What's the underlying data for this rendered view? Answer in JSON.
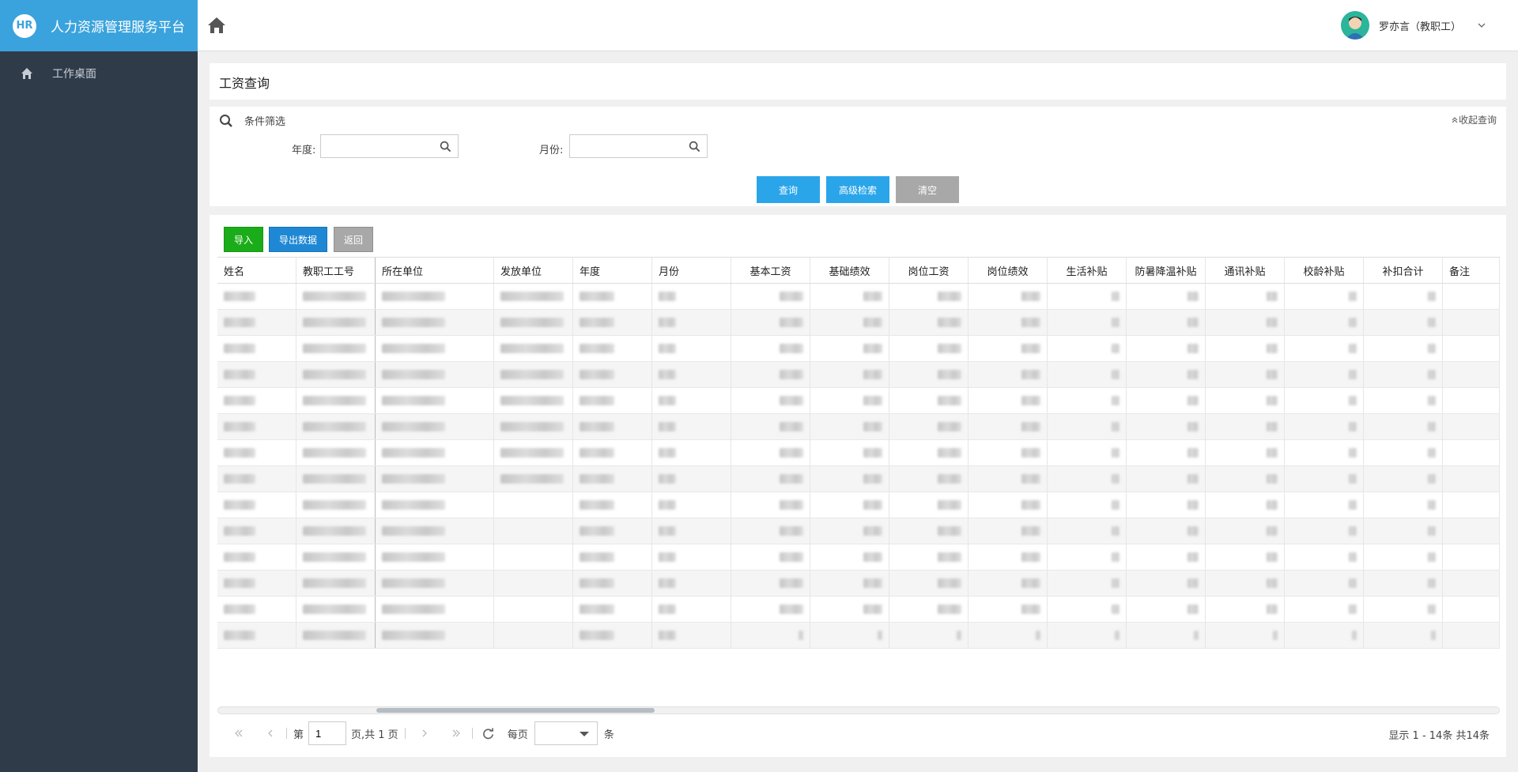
{
  "app": {
    "logo_text": "HR",
    "title": "人力资源管理服务平台"
  },
  "sidebar": {
    "items": [
      {
        "label": "工作桌面",
        "icon": "home-icon"
      }
    ]
  },
  "topbar": {
    "user_name": "罗亦言（教职工）"
  },
  "page": {
    "title": "工资查询"
  },
  "filter": {
    "header": "条件筛选",
    "collapse_label": "收起查询",
    "year_label": "年度:",
    "year_value": "",
    "month_label": "月份:",
    "month_value": "",
    "query_label": "查询",
    "advanced_label": "高级检索",
    "clear_label": "清空"
  },
  "toolbar": {
    "import_label": "导入",
    "export_label": "导出数据",
    "back_label": "返回"
  },
  "table": {
    "columns": [
      "姓名",
      "教职工工号",
      "所在单位",
      "发放单位",
      "年度",
      "月份",
      "基本工资",
      "基础绩效",
      "岗位工资",
      "岗位绩效",
      "生活补贴",
      "防暑降温补贴",
      "通讯补贴",
      "校龄补贴",
      "补扣合计",
      "备注"
    ],
    "row_count": 14,
    "rows_with_issuer": 8
  },
  "pager": {
    "page_prefix": "第",
    "page_value": "1",
    "page_suffix": "页,共 1 页",
    "per_page_prefix": "每页",
    "per_page_value": "",
    "per_page_suffix": "条",
    "info": "显示 1 - 14条 共14条"
  },
  "colors": {
    "brand": "#3aa3dd",
    "sidebar": "#2f3b49",
    "primary": "#2aa5ea",
    "success": "#1aad19",
    "export": "#1e88d4",
    "muted": "#a8a8a8"
  }
}
